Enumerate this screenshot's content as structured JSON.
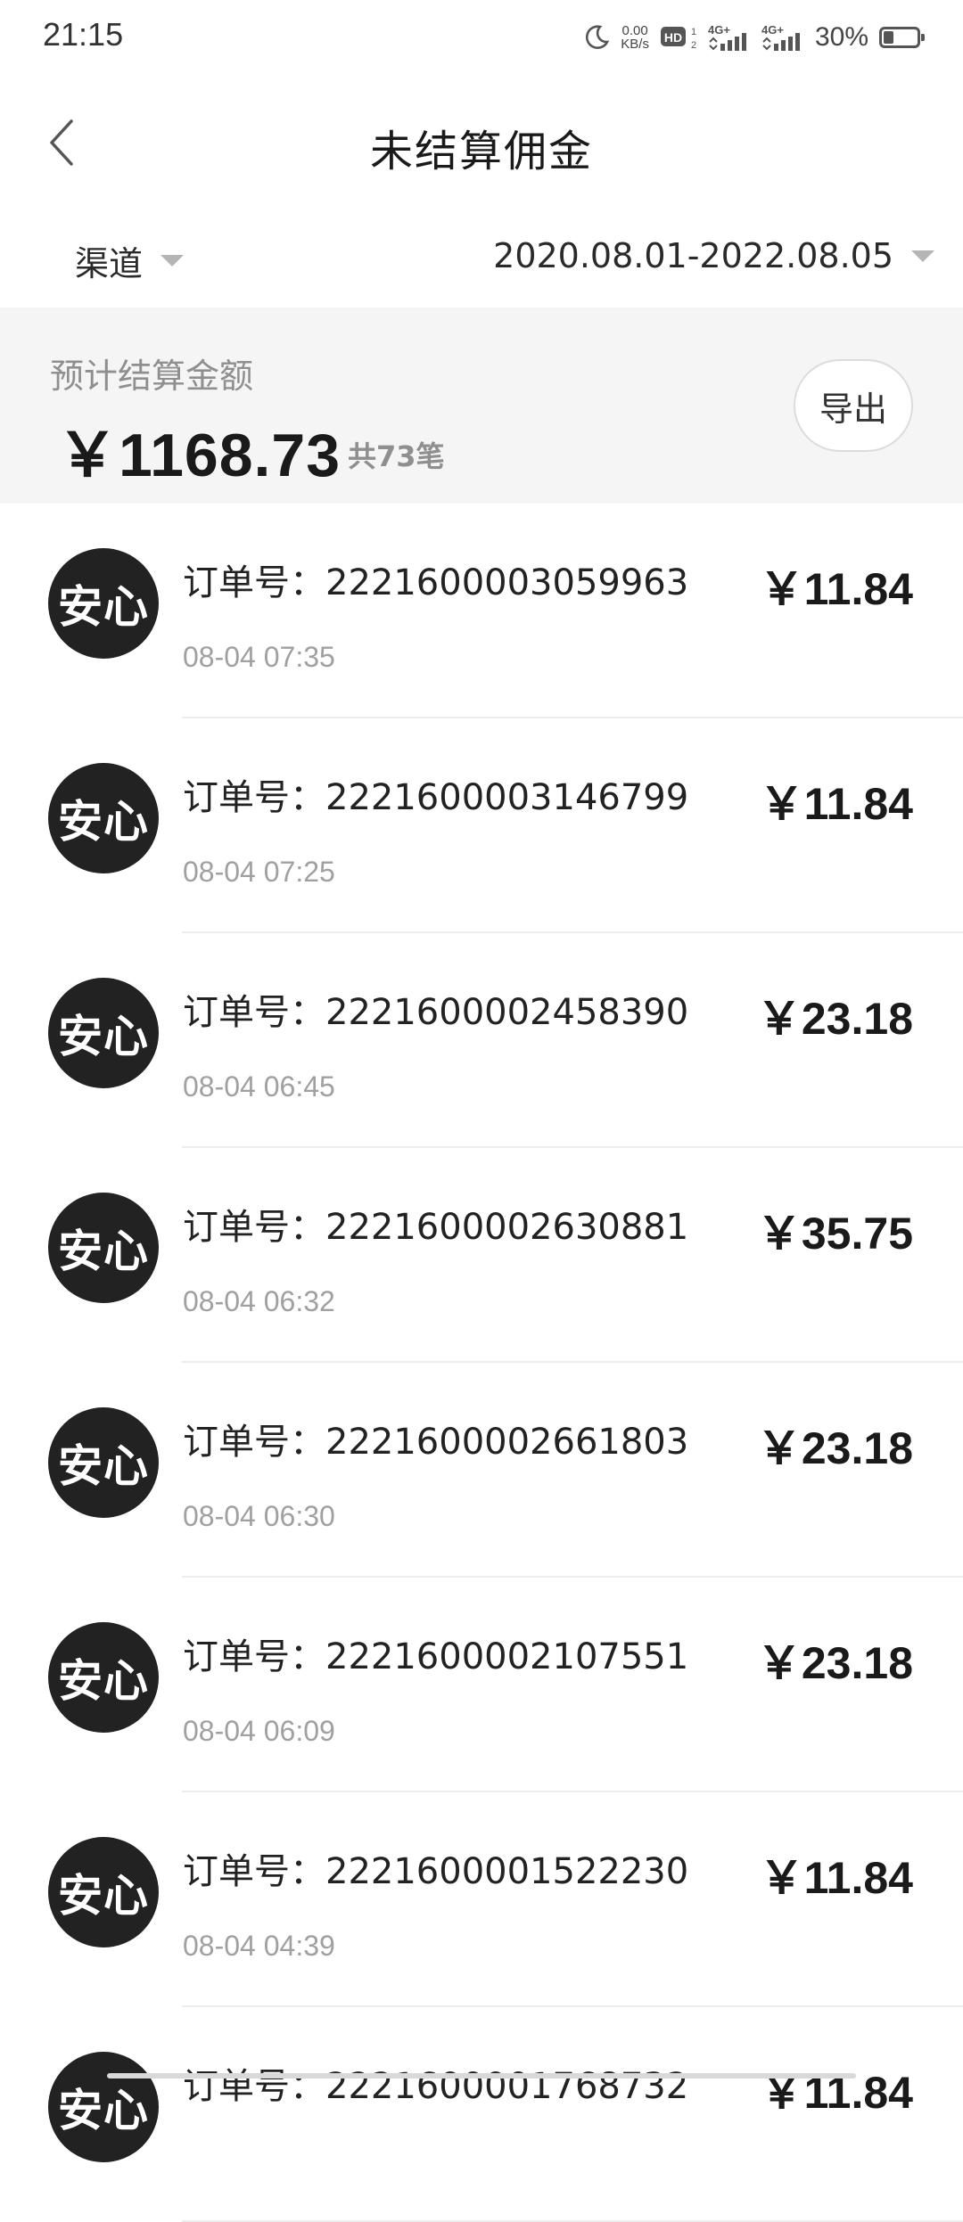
{
  "status_bar": {
    "time": "21:15",
    "net_speed_value": "0.00",
    "net_speed_unit": "KB/s",
    "hd_label": "HD",
    "signal1_label": "4G+",
    "signal2_label": "4G+",
    "battery_percent": "30%",
    "battery_level": 0.3,
    "icons": [
      "moon-icon",
      "hd-icon",
      "signal-icon",
      "battery-icon"
    ]
  },
  "header": {
    "title": "未结算佣金",
    "back_icon": "chevron-left-icon"
  },
  "filters": {
    "channel_label": "渠道",
    "date_range": "2020.08.01-2022.08.05"
  },
  "summary": {
    "label": "预计结算金额",
    "amount": "￥1168.73",
    "count": "共73笔",
    "export_label": "导出"
  },
  "orders": [
    {
      "badge": "安心",
      "order_no": "订单号：2221600003059963",
      "time": "08-04 07:35",
      "amount": "￥11.84"
    },
    {
      "badge": "安心",
      "order_no": "订单号：2221600003146799",
      "time": "08-04 07:25",
      "amount": "￥11.84"
    },
    {
      "badge": "安心",
      "order_no": "订单号：2221600002458390",
      "time": "08-04 06:45",
      "amount": "￥23.18"
    },
    {
      "badge": "安心",
      "order_no": "订单号：2221600002630881",
      "time": "08-04 06:32",
      "amount": "￥35.75"
    },
    {
      "badge": "安心",
      "order_no": "订单号：2221600002661803",
      "time": "08-04 06:30",
      "amount": "￥23.18"
    },
    {
      "badge": "安心",
      "order_no": "订单号：2221600002107551",
      "time": "08-04 06:09",
      "amount": "￥23.18"
    },
    {
      "badge": "安心",
      "order_no": "订单号：2221600001522230",
      "time": "08-04 04:39",
      "amount": "￥11.84"
    },
    {
      "badge": "安心",
      "order_no": "订单号：2221600001768732",
      "time": "",
      "amount": "￥11.84"
    }
  ]
}
